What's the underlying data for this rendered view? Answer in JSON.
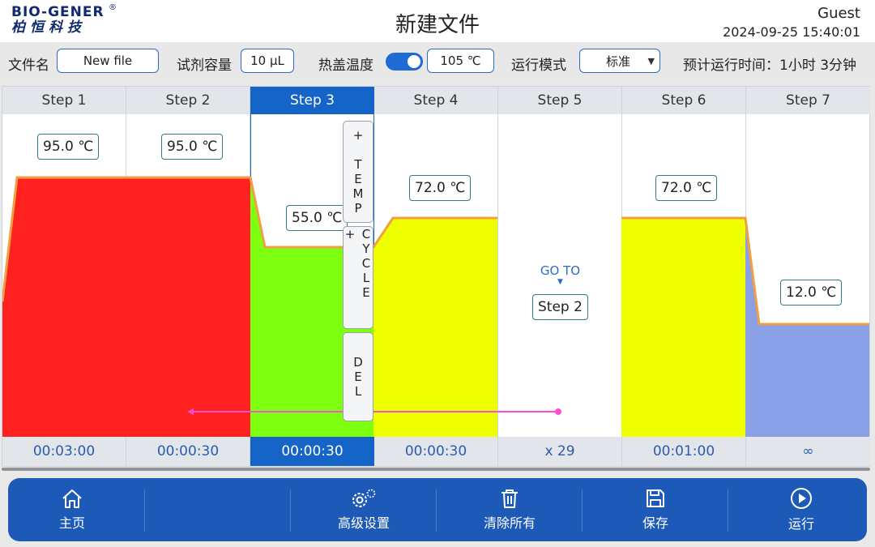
{
  "header": {
    "logo_en": "BIO-GENER",
    "logo_reg": "®",
    "logo_cn": "柏恒科技",
    "title": "新建文件",
    "user": "Guest",
    "datetime": "2024-09-25 15:40:01"
  },
  "settings": {
    "filename_label": "文件名",
    "filename_value": "New file",
    "volume_label": "试剂容量",
    "volume_value": "10 μL",
    "lid_label": "热盖温度",
    "lid_enabled": true,
    "lid_value": "105 ℃",
    "mode_label": "运行模式",
    "mode_value": "标准",
    "estimate_text": "预计运行时间：1小时 3分钟"
  },
  "steps": [
    {
      "label": "Step 1",
      "temp": "95.0 ℃",
      "time": "00:03:00",
      "color": "#ff2020"
    },
    {
      "label": "Step 2",
      "temp": "95.0 ℃",
      "time": "00:00:30",
      "color": "#ff2020"
    },
    {
      "label": "Step 3",
      "temp": "55.0 ℃",
      "time": "00:00:30",
      "color": "#7dff10",
      "selected": true
    },
    {
      "label": "Step 4",
      "temp": "72.0 ℃",
      "time": "00:00:30",
      "color": "#eeff00"
    },
    {
      "label": "Step 5",
      "goto_label": "GO TO",
      "goto_target": "Step 2",
      "time": "x 29"
    },
    {
      "label": "Step 6",
      "temp": "72.0 ℃",
      "time": "00:01:00",
      "color": "#eeff00"
    },
    {
      "label": "Step 7",
      "temp": "12.0 ℃",
      "time": "∞",
      "color": "#8aa0e6"
    }
  ],
  "step_actions": {
    "add_temp": "+ TEMP",
    "add_cycle": "+ CYCLE",
    "delete": "DEL"
  },
  "colors": {
    "accent": "#1565c9",
    "profile_line": "#f0a040",
    "loop_arrow": "#ff4fd8"
  },
  "nav": {
    "home": "主页",
    "advanced": "高级设置",
    "clear_all": "清除所有",
    "save": "保存",
    "run": "运行"
  }
}
